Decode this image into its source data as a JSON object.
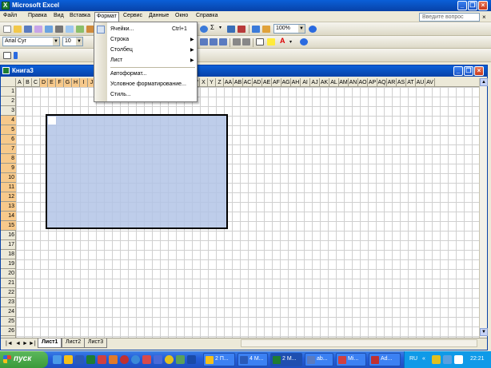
{
  "window": {
    "title": "Microsoft Excel"
  },
  "menu": {
    "items": [
      "Файл",
      "Правка",
      "Вид",
      "Вставка",
      "Формат",
      "Сервис",
      "Данные",
      "Окно",
      "Справка"
    ],
    "help_placeholder": "Введите вопрос",
    "close": "×"
  },
  "toolbar": {
    "font": "Arial Cyr",
    "size": "10",
    "zoom": "100%"
  },
  "format_menu": {
    "items": [
      {
        "label": "Ячейки...",
        "shortcut": "Ctrl+1",
        "submenu": false,
        "icon": "cells-icon"
      },
      {
        "label": "Строка",
        "submenu": true
      },
      {
        "label": "Столбец",
        "submenu": true
      },
      {
        "label": "Лист",
        "submenu": true
      },
      {
        "label": "Автоформат..."
      },
      {
        "label": "Условное форматирование..."
      },
      {
        "label": "Стиль..."
      }
    ]
  },
  "workbook": {
    "title": "Книга3",
    "columns": [
      "A",
      "B",
      "C",
      "D",
      "E",
      "F",
      "G",
      "H",
      "I",
      "J",
      "K",
      "L",
      "M",
      "N",
      "O",
      "P",
      "Q",
      "R",
      "S",
      "T",
      "U",
      "V",
      "W",
      "X",
      "Y",
      "Z",
      "AA",
      "AB",
      "AC",
      "AD",
      "AE",
      "AF",
      "AG",
      "AH",
      "AI",
      "AJ",
      "AK",
      "AL",
      "AM",
      "AN",
      "AO",
      "AP",
      "AQ",
      "AR",
      "AS",
      "AT",
      "AU",
      "AV"
    ],
    "selected_columns": [
      "D",
      "E",
      "F",
      "G",
      "H",
      "I",
      "J",
      "K",
      "L",
      "M",
      "N",
      "O",
      "P",
      "Q",
      "R",
      "S",
      "T",
      "U",
      "V"
    ],
    "rows": [
      "1",
      "2",
      "3",
      "4",
      "5",
      "6",
      "7",
      "8",
      "9",
      "10",
      "11",
      "12",
      "13",
      "14",
      "15",
      "16",
      "17",
      "18",
      "19",
      "20",
      "21",
      "22",
      "23",
      "24",
      "25",
      "26"
    ],
    "selected_rows": [
      "4",
      "5",
      "6",
      "7",
      "8",
      "9",
      "10",
      "11",
      "12",
      "13",
      "14",
      "15"
    ],
    "sheets": [
      "Лист1",
      "Лист2",
      "Лист3"
    ],
    "active_sheet": "Лист1"
  },
  "taskbar": {
    "start_label": "пуск",
    "tasks": [
      "2 П...",
      "4 М...",
      "2 М...",
      "ab...",
      "Mi...",
      "Ad..."
    ],
    "lang": "RU",
    "clock": "22:21"
  },
  "colors": {
    "title_blue": "#0a5fd8",
    "selection": "#b3c4e6",
    "header_highlight": "#f7c98b"
  }
}
